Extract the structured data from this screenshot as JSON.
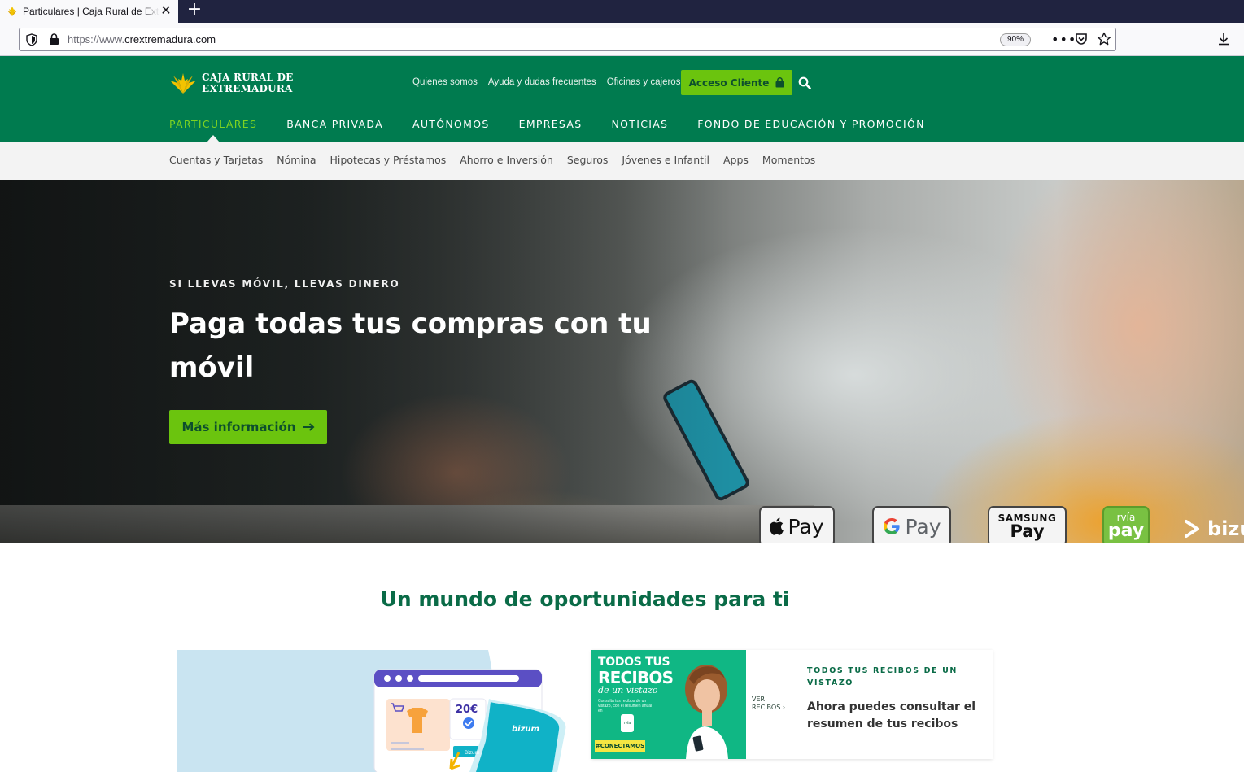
{
  "browser": {
    "tab_title": "Particulares | Caja Rural de Extremadura",
    "url_protocol": "https://www.",
    "url_domain": "crextremadura.com",
    "zoom": "90%",
    "new_tab_symbol": "+",
    "close_symbol": "✕",
    "menu_dots": "•••"
  },
  "site": {
    "logo_line1": "CAJA RURAL DE",
    "logo_line2": "EXTREMADURA",
    "brand_color": "#007b4f",
    "accent_color": "#6bc40e",
    "top_links": [
      "Quienes somos",
      "Ayuda y dudas frecuentes",
      "Oficinas y cajeros"
    ],
    "access_button": "Acceso Cliente",
    "main_nav": [
      "PARTICULARES",
      "BANCA PRIVADA",
      "AUTÓNOMOS",
      "EMPRESAS",
      "NOTICIAS",
      "FONDO DE EDUCACIÓN Y PROMOCIÓN"
    ],
    "main_nav_active": "PARTICULARES",
    "sub_nav": [
      "Cuentas y Tarjetas",
      "Nómina",
      "Hipotecas y Préstamos",
      "Ahorro e Inversión",
      "Seguros",
      "Jóvenes e Infantil",
      "Apps",
      "Momentos"
    ]
  },
  "hero": {
    "eyebrow": "SI LLEVAS MÓVIL, LLEVAS DINERO",
    "title": "Paga todas tus compras con tu móvil",
    "cta": "Más información",
    "badges": {
      "apple": "Pay",
      "google": "Pay",
      "samsung_top": "SAMSUNG",
      "samsung_bottom": "Pay",
      "ruralvia_top": "rvía",
      "ruralvia_bottom": "pay",
      "bizum": "bizu"
    }
  },
  "opportunities": {
    "title": "Un mundo de oportunidades para ti",
    "bizum_card": {
      "price": "20€",
      "bizum_label": "bizum",
      "bizum_small": "Bizum"
    },
    "recibos_card": {
      "image_line1": "TODOS TUS",
      "image_line2": "RECIBOS",
      "image_line3": "de un vistazo",
      "image_small": "Consulta tus recibos de un vistazo, con el resumen anual en",
      "image_phone": "rvía",
      "image_tag": "#CONECTAMOS",
      "side_link": "VER RECIBOS ›",
      "kicker": "TODOS TUS RECIBOS DE UN VISTAZO",
      "text": "Ahora puedes consultar el resumen de tus recibos"
    }
  }
}
